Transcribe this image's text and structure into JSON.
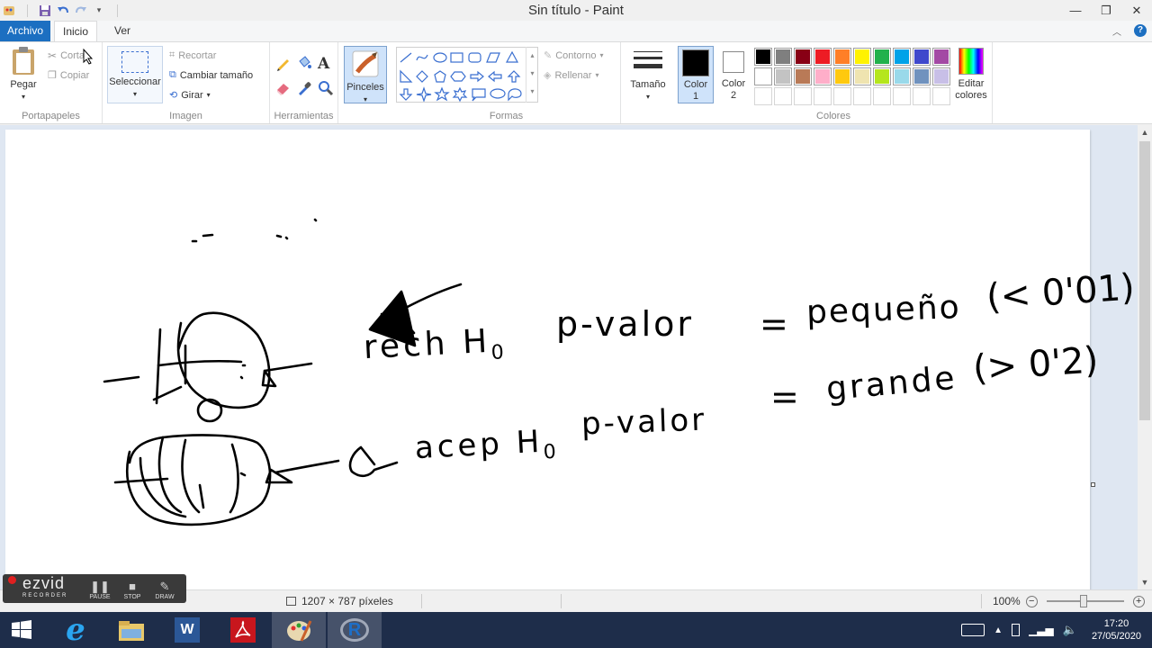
{
  "window": {
    "title": "Sin título - Paint",
    "minimize": "—",
    "maximize": "❐",
    "close": "✕"
  },
  "tabs": {
    "file": "Archivo",
    "home": "Inicio",
    "view": "Ver"
  },
  "ribbon": {
    "clipboard": {
      "paste": "Pegar",
      "cut": "Cortar",
      "copy": "Copiar",
      "label": "Portapapeles"
    },
    "image": {
      "select": "Seleccionar",
      "crop": "Recortar",
      "resize": "Cambiar tamaño",
      "rotate": "Girar",
      "label": "Imagen"
    },
    "tools": {
      "label": "Herramientas",
      "text_tool": "A"
    },
    "brushes": {
      "label": "Pinceles"
    },
    "shapes": {
      "outline": "Contorno",
      "fill": "Rellenar",
      "label": "Formas"
    },
    "size": {
      "label": "Tamaño"
    },
    "colors": {
      "color1_label": "Color",
      "color1_num": "1",
      "color2_label": "Color",
      "color2_num": "2",
      "edit_label": "Editar",
      "edit_label2": "colores",
      "label": "Colores",
      "color1": "#000000",
      "color2": "#ffffff",
      "palette_row1": [
        "#000000",
        "#7f7f7f",
        "#880015",
        "#ed1c24",
        "#ff7f27",
        "#fff200",
        "#22b14c",
        "#00a2e8",
        "#3f48cc",
        "#a349a4"
      ],
      "palette_row2": [
        "#ffffff",
        "#c3c3c3",
        "#b97a57",
        "#ffaec9",
        "#ffc90e",
        "#efe4b0",
        "#b5e61d",
        "#99d9ea",
        "#7092be",
        "#c8bfe7"
      ],
      "palette_row3": [
        "#ffffff",
        "#ffffff",
        "#ffffff",
        "#ffffff",
        "#ffffff",
        "#ffffff",
        "#ffffff",
        "#ffffff",
        "#ffffff",
        "#ffffff"
      ]
    }
  },
  "status": {
    "canvas_size": "1207 × 787 píxeles",
    "zoom": "100%"
  },
  "recorder": {
    "logo": "ezvid",
    "sub": "RECORDER",
    "pause": "PAUSE",
    "stop": "STOP",
    "draw": "DRAW"
  },
  "canvas_text": {
    "line1_left": "rech H",
    "line1_sub": "0",
    "line1_mid": "p-valor",
    "line1_eq": "=",
    "line1_right": "pequeño",
    "line1_paren": "(< 0'01)",
    "line2_mid": "p-valor",
    "line2_eq": "=",
    "line2_right": "grande",
    "line2_paren": "(> 0'2)",
    "line3": "acep H",
    "line3_sub": "0",
    "line3_mid": "p-valor"
  },
  "taskbar": {
    "time": "17:20",
    "date": "27/05/2020",
    "word_letter": "W",
    "r_letter": "R"
  }
}
